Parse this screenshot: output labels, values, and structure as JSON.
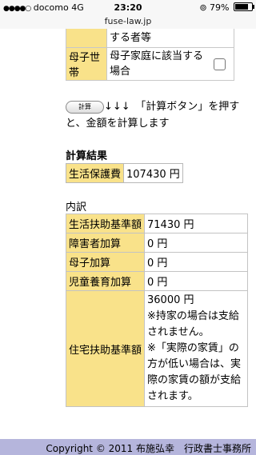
{
  "status_bar": {
    "signal": "●●●●○",
    "carrier": "docomo",
    "network": "4G",
    "time": "23:20",
    "battery": "79%"
  },
  "browser": {
    "url": "fuse-law.jp"
  },
  "top_rows": [
    {
      "label": "",
      "text": "する者等"
    },
    {
      "label": "母子世帯",
      "text": "母子家庭に該当する場合",
      "checked": false
    }
  ],
  "calc": {
    "button_label": "計算",
    "arrows": "↓↓↓",
    "instruction": "「計算ボタン」を押すと、金額を計算します"
  },
  "result": {
    "title": "計算結果",
    "label": "生活保護費",
    "value": "107430 円"
  },
  "breakdown": {
    "title": "内訳",
    "rows": [
      {
        "label": "生活扶助基準額",
        "value": "71430 円"
      },
      {
        "label": "障害者加算",
        "value": "0 円"
      },
      {
        "label": "母子加算",
        "value": "0 円"
      },
      {
        "label": "児童養育加算",
        "value": "0 円"
      }
    ],
    "housing": {
      "label": "住宅扶助基準額",
      "value": "36000 円",
      "note1": "※持家の場合は支給されません。",
      "note2": "※「実際の家賃」の方が低い場合は、実際の家賃の額が支給されます。"
    }
  },
  "footer": {
    "copyright": "Copyright © 2011 布施弘幸　行政書士事務所"
  }
}
